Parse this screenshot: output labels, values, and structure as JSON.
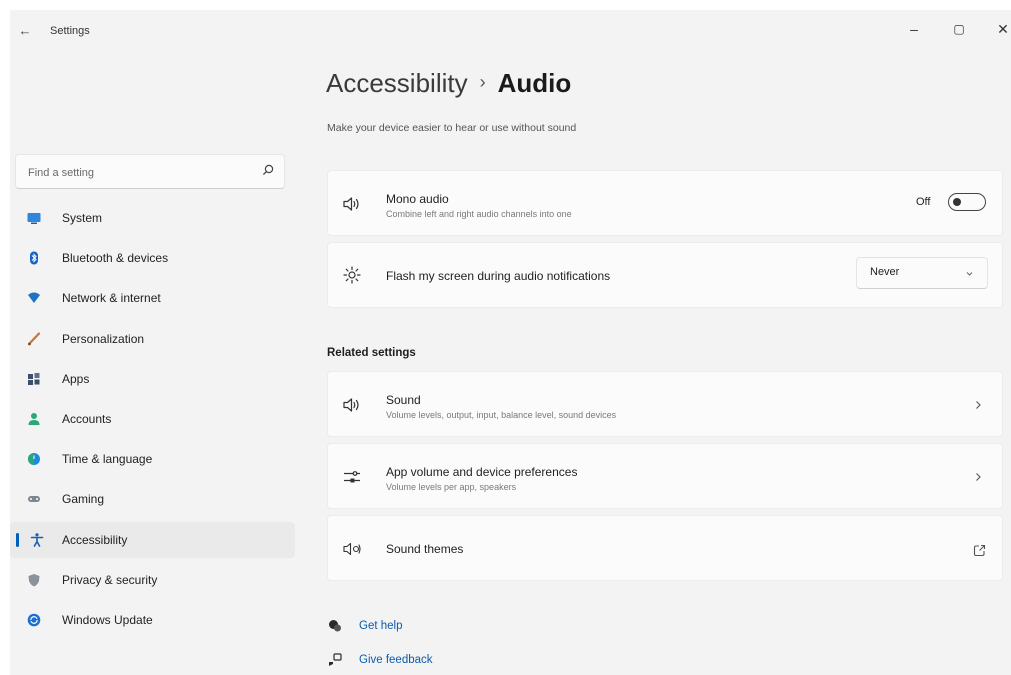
{
  "window": {
    "back_glyph": "←",
    "title": "Settings",
    "minimize_glyph": "–",
    "maximize_glyph": "▢",
    "close_glyph": "✕"
  },
  "search": {
    "placeholder": "Find a setting",
    "icon": "search-icon"
  },
  "sidebar": {
    "items": [
      {
        "label": "System",
        "icon": "monitor-icon",
        "color": "#2e86de"
      },
      {
        "label": "Bluetooth & devices",
        "icon": "bluetooth-icon",
        "color": "#1565c0"
      },
      {
        "label": "Network & internet",
        "icon": "wifi-icon",
        "color": "#1e73c7"
      },
      {
        "label": "Personalization",
        "icon": "brush-icon",
        "color": "#c8743a"
      },
      {
        "label": "Apps",
        "icon": "apps-icon",
        "color": "#3b5068"
      },
      {
        "label": "Accounts",
        "icon": "person-icon",
        "color": "#2aa876"
      },
      {
        "label": "Time & language",
        "icon": "globe-clock-icon",
        "color": "#1e88e5"
      },
      {
        "label": "Gaming",
        "icon": "gamepad-icon",
        "color": "#7a8792"
      },
      {
        "label": "Accessibility",
        "icon": "accessibility-icon",
        "color": "#1a5fb4",
        "selected": true
      },
      {
        "label": "Privacy & security",
        "icon": "shield-icon",
        "color": "#8a939c"
      },
      {
        "label": "Windows Update",
        "icon": "update-icon",
        "color": "#1e6fd0"
      }
    ]
  },
  "header": {
    "parent": "Accessibility",
    "separator": "›",
    "current": "Audio",
    "subtitle": "Make your device easier to hear or use without sound"
  },
  "settings": {
    "mono_audio": {
      "title": "Mono audio",
      "description": "Combine left and right audio channels into one",
      "state_label": "Off",
      "enabled": false,
      "icon": "speaker-icon"
    },
    "flash_screen": {
      "title": "Flash my screen during audio notifications",
      "value": "Never",
      "icon": "brightness-icon"
    }
  },
  "related": {
    "heading": "Related settings",
    "items": [
      {
        "title": "Sound",
        "description": "Volume levels, output, input, balance level, sound devices",
        "icon": "speaker-icon",
        "action": "chevron-right-icon"
      },
      {
        "title": "App volume and device preferences",
        "description": "Volume levels per app, speakers",
        "icon": "mixer-icon",
        "action": "chevron-right-icon"
      },
      {
        "title": "Sound themes",
        "icon": "sound-theme-icon",
        "action": "external-link-icon"
      }
    ]
  },
  "help": {
    "get_help": "Get help",
    "give_feedback": "Give feedback"
  },
  "colors": {
    "accent": "#005fb8",
    "link": "#0b5cad",
    "background": "#f3f3f3",
    "card": "#fbfbfb"
  }
}
